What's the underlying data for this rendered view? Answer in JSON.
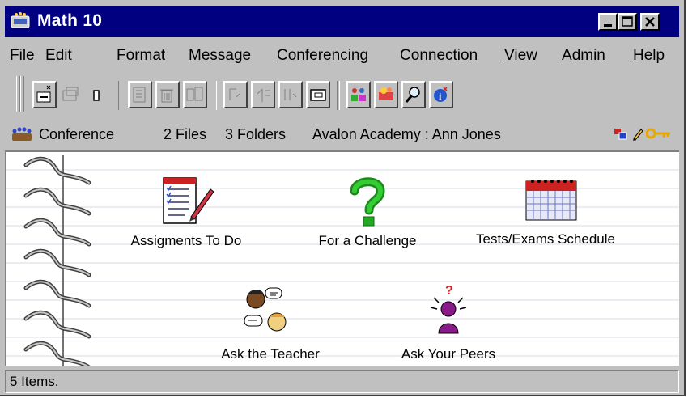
{
  "window": {
    "title": "Math 10"
  },
  "menubar": {
    "items": [
      {
        "pre": "",
        "u": "F",
        "post": "ile"
      },
      {
        "pre": "",
        "u": "E",
        "post": "dit"
      },
      {
        "pre": "Fo",
        "u": "r",
        "post": "mat"
      },
      {
        "pre": "",
        "u": "M",
        "post": "essage"
      },
      {
        "pre": "",
        "u": "C",
        "post": "onferencing"
      },
      {
        "pre": "C",
        "u": "o",
        "post": "nnection"
      },
      {
        "pre": "",
        "u": "V",
        "post": "iew"
      },
      {
        "pre": "",
        "u": "A",
        "post": "dmin"
      },
      {
        "pre": "",
        "u": "H",
        "post": "elp"
      }
    ]
  },
  "infobar": {
    "type": "Conference",
    "files": "2 Files",
    "folders": "3 Folders",
    "path": "Avalon Academy : Ann Jones"
  },
  "items": [
    {
      "label": "Assigments To Do",
      "icon": "clipboard-checklist-icon"
    },
    {
      "label": "For a Challenge",
      "icon": "question-mark-icon"
    },
    {
      "label": "Tests/Exams Schedule",
      "icon": "calendar-icon"
    },
    {
      "label": "Ask the Teacher",
      "icon": "chat-people-icon"
    },
    {
      "label": "Ask Your Peers",
      "icon": "thinking-person-icon"
    }
  ],
  "statusbar": {
    "text": "5 Items."
  },
  "colors": {
    "titlebar": "#000080",
    "chrome": "#c0c0c0",
    "question_green": "#22aa22",
    "peer_purple": "#8a1a8a"
  }
}
